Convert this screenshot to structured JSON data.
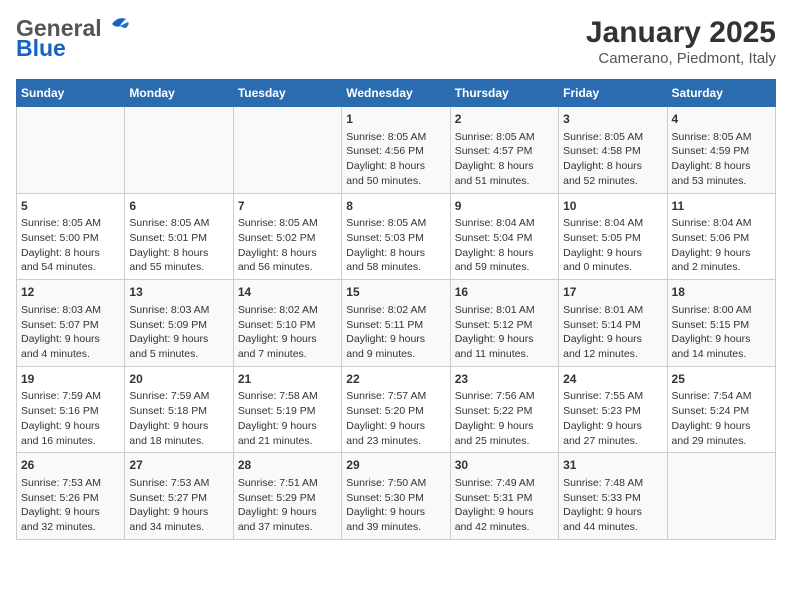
{
  "header": {
    "logo_general": "General",
    "logo_blue": "Blue",
    "title": "January 2025",
    "subtitle": "Camerano, Piedmont, Italy"
  },
  "days_of_week": [
    "Sunday",
    "Monday",
    "Tuesday",
    "Wednesday",
    "Thursday",
    "Friday",
    "Saturday"
  ],
  "weeks": [
    [
      {
        "day": "",
        "content": ""
      },
      {
        "day": "",
        "content": ""
      },
      {
        "day": "",
        "content": ""
      },
      {
        "day": "1",
        "content": "Sunrise: 8:05 AM\nSunset: 4:56 PM\nDaylight: 8 hours\nand 50 minutes."
      },
      {
        "day": "2",
        "content": "Sunrise: 8:05 AM\nSunset: 4:57 PM\nDaylight: 8 hours\nand 51 minutes."
      },
      {
        "day": "3",
        "content": "Sunrise: 8:05 AM\nSunset: 4:58 PM\nDaylight: 8 hours\nand 52 minutes."
      },
      {
        "day": "4",
        "content": "Sunrise: 8:05 AM\nSunset: 4:59 PM\nDaylight: 8 hours\nand 53 minutes."
      }
    ],
    [
      {
        "day": "5",
        "content": "Sunrise: 8:05 AM\nSunset: 5:00 PM\nDaylight: 8 hours\nand 54 minutes."
      },
      {
        "day": "6",
        "content": "Sunrise: 8:05 AM\nSunset: 5:01 PM\nDaylight: 8 hours\nand 55 minutes."
      },
      {
        "day": "7",
        "content": "Sunrise: 8:05 AM\nSunset: 5:02 PM\nDaylight: 8 hours\nand 56 minutes."
      },
      {
        "day": "8",
        "content": "Sunrise: 8:05 AM\nSunset: 5:03 PM\nDaylight: 8 hours\nand 58 minutes."
      },
      {
        "day": "9",
        "content": "Sunrise: 8:04 AM\nSunset: 5:04 PM\nDaylight: 8 hours\nand 59 minutes."
      },
      {
        "day": "10",
        "content": "Sunrise: 8:04 AM\nSunset: 5:05 PM\nDaylight: 9 hours\nand 0 minutes."
      },
      {
        "day": "11",
        "content": "Sunrise: 8:04 AM\nSunset: 5:06 PM\nDaylight: 9 hours\nand 2 minutes."
      }
    ],
    [
      {
        "day": "12",
        "content": "Sunrise: 8:03 AM\nSunset: 5:07 PM\nDaylight: 9 hours\nand 4 minutes."
      },
      {
        "day": "13",
        "content": "Sunrise: 8:03 AM\nSunset: 5:09 PM\nDaylight: 9 hours\nand 5 minutes."
      },
      {
        "day": "14",
        "content": "Sunrise: 8:02 AM\nSunset: 5:10 PM\nDaylight: 9 hours\nand 7 minutes."
      },
      {
        "day": "15",
        "content": "Sunrise: 8:02 AM\nSunset: 5:11 PM\nDaylight: 9 hours\nand 9 minutes."
      },
      {
        "day": "16",
        "content": "Sunrise: 8:01 AM\nSunset: 5:12 PM\nDaylight: 9 hours\nand 11 minutes."
      },
      {
        "day": "17",
        "content": "Sunrise: 8:01 AM\nSunset: 5:14 PM\nDaylight: 9 hours\nand 12 minutes."
      },
      {
        "day": "18",
        "content": "Sunrise: 8:00 AM\nSunset: 5:15 PM\nDaylight: 9 hours\nand 14 minutes."
      }
    ],
    [
      {
        "day": "19",
        "content": "Sunrise: 7:59 AM\nSunset: 5:16 PM\nDaylight: 9 hours\nand 16 minutes."
      },
      {
        "day": "20",
        "content": "Sunrise: 7:59 AM\nSunset: 5:18 PM\nDaylight: 9 hours\nand 18 minutes."
      },
      {
        "day": "21",
        "content": "Sunrise: 7:58 AM\nSunset: 5:19 PM\nDaylight: 9 hours\nand 21 minutes."
      },
      {
        "day": "22",
        "content": "Sunrise: 7:57 AM\nSunset: 5:20 PM\nDaylight: 9 hours\nand 23 minutes."
      },
      {
        "day": "23",
        "content": "Sunrise: 7:56 AM\nSunset: 5:22 PM\nDaylight: 9 hours\nand 25 minutes."
      },
      {
        "day": "24",
        "content": "Sunrise: 7:55 AM\nSunset: 5:23 PM\nDaylight: 9 hours\nand 27 minutes."
      },
      {
        "day": "25",
        "content": "Sunrise: 7:54 AM\nSunset: 5:24 PM\nDaylight: 9 hours\nand 29 minutes."
      }
    ],
    [
      {
        "day": "26",
        "content": "Sunrise: 7:53 AM\nSunset: 5:26 PM\nDaylight: 9 hours\nand 32 minutes."
      },
      {
        "day": "27",
        "content": "Sunrise: 7:53 AM\nSunset: 5:27 PM\nDaylight: 9 hours\nand 34 minutes."
      },
      {
        "day": "28",
        "content": "Sunrise: 7:51 AM\nSunset: 5:29 PM\nDaylight: 9 hours\nand 37 minutes."
      },
      {
        "day": "29",
        "content": "Sunrise: 7:50 AM\nSunset: 5:30 PM\nDaylight: 9 hours\nand 39 minutes."
      },
      {
        "day": "30",
        "content": "Sunrise: 7:49 AM\nSunset: 5:31 PM\nDaylight: 9 hours\nand 42 minutes."
      },
      {
        "day": "31",
        "content": "Sunrise: 7:48 AM\nSunset: 5:33 PM\nDaylight: 9 hours\nand 44 minutes."
      },
      {
        "day": "",
        "content": ""
      }
    ]
  ]
}
